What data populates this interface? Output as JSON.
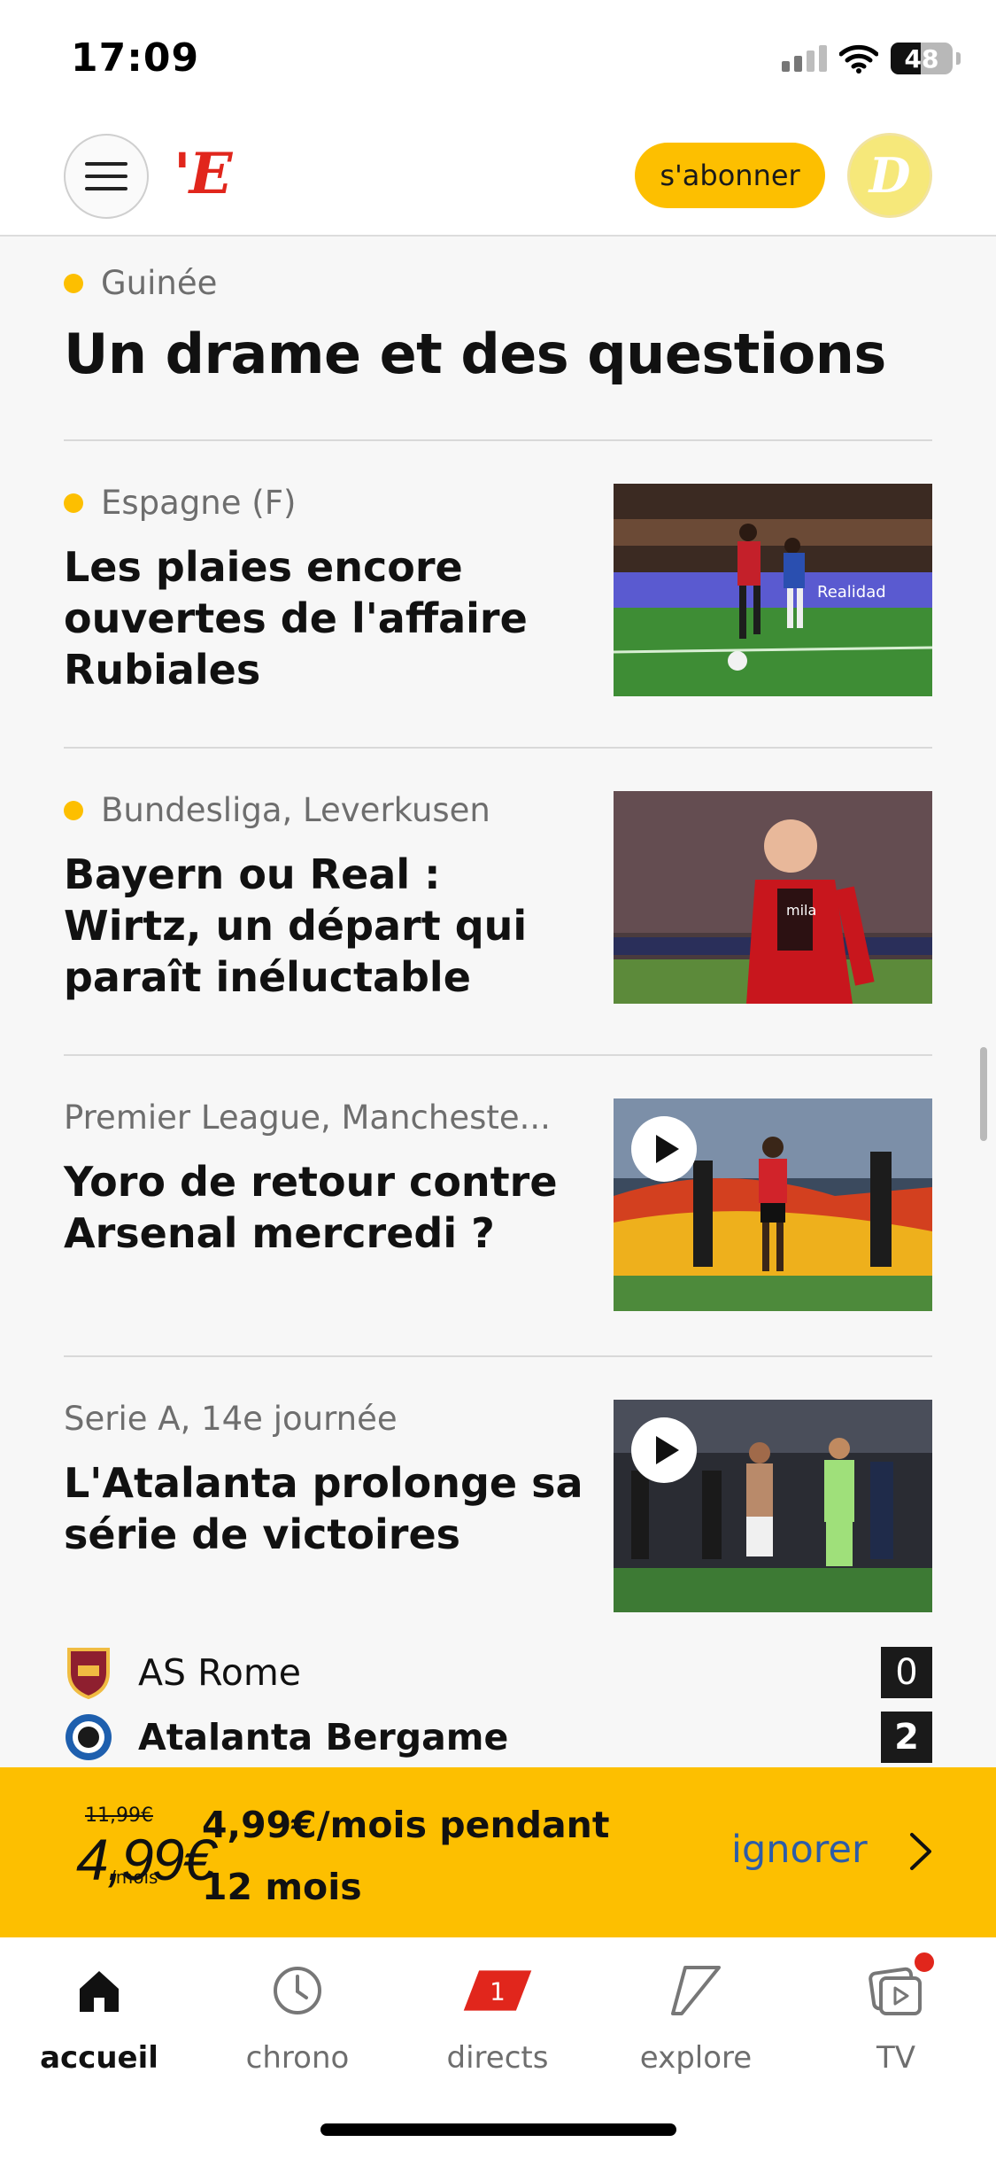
{
  "status_bar": {
    "time": "17:09",
    "battery": "48",
    "battery_level": 0.48
  },
  "header": {
    "logo": "'E",
    "subscribe_label": "s'abonner",
    "avatar_letter": "D"
  },
  "top_story": {
    "kicker": "Guinée",
    "title": "Un drame et des questions"
  },
  "articles": [
    {
      "kicker": "Espagne (F)",
      "title": "Les plaies encore ouvertes de l'affaire Rubiales",
      "has_dot": true,
      "video": false,
      "thumb_text": "Realidad"
    },
    {
      "kicker": "Bundesliga, Leverkusen",
      "title": "Bayern ou Real : Wirtz, un départ qui paraît inéluctable",
      "has_dot": true,
      "video": false,
      "thumb_text": "mila"
    },
    {
      "kicker": "Premier League, Mancheste...",
      "title": "Yoro de retour contre Arsenal mercredi ?",
      "has_dot": false,
      "video": true,
      "thumb_text": ""
    },
    {
      "kicker": "Serie A, 14e journée",
      "title": "L'Atalanta prolonge sa série de victoires",
      "has_dot": false,
      "video": true,
      "thumb_text": ""
    }
  ],
  "scoreboard": [
    {
      "team": "AS Rome",
      "score": "0",
      "winner": false
    },
    {
      "team": "Atalanta Bergame",
      "score": "2",
      "winner": true
    }
  ],
  "promo": {
    "old_price": "11,99€",
    "price": "4,99€",
    "price_asterisk": "*",
    "per_month": "/mois",
    "offer": "4,99€/mois pendant 12 mois",
    "ignore_label": "ignorer"
  },
  "tabbar": {
    "items": [
      {
        "label": "accueil",
        "icon": "home-icon",
        "active": true
      },
      {
        "label": "chrono",
        "icon": "clock-icon",
        "active": false
      },
      {
        "label": "directs",
        "icon": "live-badge-icon",
        "badge": "1",
        "active": false
      },
      {
        "label": "explore",
        "icon": "explore-icon",
        "active": false
      },
      {
        "label": "TV",
        "icon": "tv-icon",
        "active": false,
        "notification": true
      }
    ]
  },
  "colors": {
    "accent": "#fdbf00",
    "brand_red": "#e1261c",
    "link_blue": "#2d5ca8"
  }
}
